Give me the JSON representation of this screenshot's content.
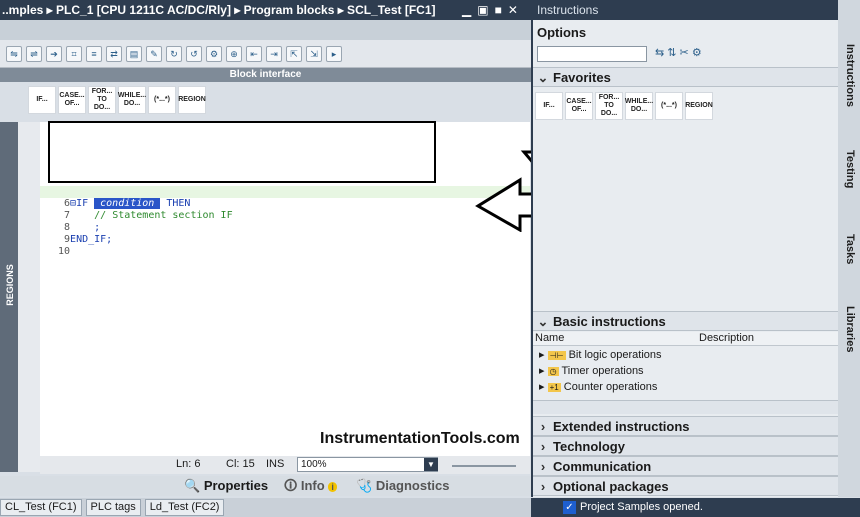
{
  "title_bar": {
    "path": "..mples ▸ PLC_1 [CPU 1211C AC/DC/Rly] ▸ Program blocks ▸ SCL_Test [FC1]",
    "minimize": "▁",
    "restore": "▣",
    "maximize": "■",
    "close": "✕"
  },
  "editor": {
    "block_interface_label": "Block interface",
    "favorites": [
      "IF...",
      "CASE... OF...",
      "FOR... TO DO...",
      "WHILE... DO...",
      "(*...*)",
      "REGION"
    ],
    "regions_label": "REGIONS",
    "lines": [
      {
        "num": "6",
        "prefix": "⊟IF ",
        "cond": "condition",
        "suffix": " THEN"
      },
      {
        "num": "7",
        "comment": "    // Statement section IF"
      },
      {
        "num": "8",
        "text": "    ;"
      },
      {
        "num": "9",
        "text": "END_IF;"
      },
      {
        "num": "10",
        "text": ""
      }
    ],
    "watermark": "InstrumentationTools.com",
    "status": {
      "ln": "Ln: 6",
      "cl": "Cl: 15",
      "ins": "INS",
      "zoom": "100%"
    }
  },
  "inspector": {
    "properties": "Properties",
    "info": "Info",
    "diagnostics": "Diagnostics"
  },
  "taskbar": {
    "items": [
      "CL_Test (FC1)",
      "PLC tags",
      "Ld_Test (FC2)"
    ]
  },
  "instructions_panel": {
    "title": "Instructions",
    "options_label": "Options",
    "favorites_label": "Favorites",
    "favorites": [
      "IF...",
      "CASE... OF...",
      "FOR... TO DO...",
      "WHILE... DO...",
      "(*...*)",
      "REGION"
    ],
    "basic_label": "Basic instructions",
    "col_name": "Name",
    "col_desc": "Description",
    "basic_rows": [
      "Bit logic operations",
      "Timer operations",
      "Counter operations"
    ],
    "sections": [
      "Extended instructions",
      "Technology",
      "Communication",
      "Optional packages"
    ],
    "status_text": "Project Samples opened."
  },
  "sidebar": {
    "tabs": [
      "Instructions",
      "Testing",
      "Tasks",
      "Libraries"
    ]
  }
}
